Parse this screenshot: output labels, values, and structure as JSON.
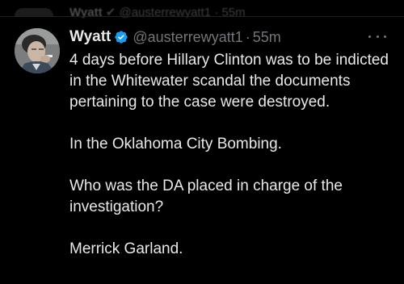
{
  "ghost_tweet": {
    "name": "Wyatt",
    "handle": "@austerrewyatt1",
    "time": "55m"
  },
  "tweet": {
    "display_name": "Wyatt",
    "handle": "@austerrewyatt1",
    "separator": "·",
    "timestamp": "55m",
    "paragraphs": [
      "4 days before Hillary Clinton was to be indicted in the Whitewater scandal the documents pertaining to the case were destroyed.",
      "In the Oklahoma City Bombing.",
      "Who was the DA placed in charge of the investigation?",
      "Merrick Garland."
    ]
  },
  "icons": {
    "verified": "verified-badge-icon",
    "more": "more-options-icon",
    "avatar": "profile-photo"
  },
  "colors": {
    "background": "#000000",
    "text": "#e7e9ea",
    "secondary": "#71767b",
    "verified": "#1d9bf0"
  }
}
